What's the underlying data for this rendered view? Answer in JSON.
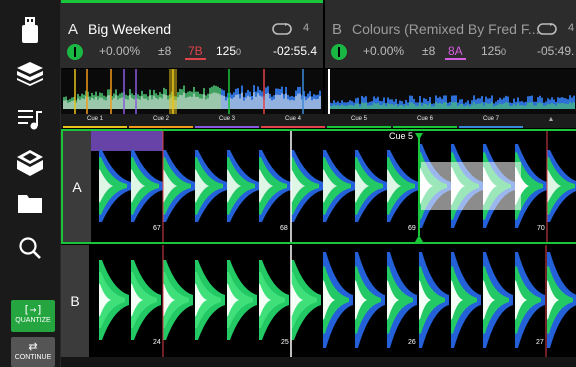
{
  "sidebar": {
    "items": [
      {
        "name": "usb-icon"
      },
      {
        "name": "crates-icon"
      },
      {
        "name": "playlist-icon"
      },
      {
        "name": "library-icon"
      },
      {
        "name": "folder-icon"
      },
      {
        "name": "search-icon"
      }
    ],
    "quantize": {
      "glyph": "[→]",
      "label": "QUANTIZE"
    },
    "continue": {
      "glyph": "⇄",
      "label": "CONTINUE"
    }
  },
  "deckA": {
    "letter": "A",
    "title": "Big Weekend",
    "loop_count": "4",
    "pitch": "+0.00%",
    "range": "±8",
    "key": "7B",
    "bpm": "125",
    "bpm_decimal": "0",
    "time": "-02:55.4",
    "key_color": "#e2424a"
  },
  "deckB": {
    "letter": "B",
    "title": "Colours (Remixed By Fred F...",
    "loop_count": "4",
    "pitch": "+0.00%",
    "range": "±8",
    "key": "8A",
    "bpm": "125",
    "bpm_decimal": "0",
    "time": "-05:49.",
    "key_color": "#d65ee0"
  },
  "cues": [
    {
      "label": "Cue 1",
      "color": "#e8c21b"
    },
    {
      "label": "Cue 2",
      "color": "#f29b1a"
    },
    {
      "label": "Cue 3",
      "color": "#8a5ae0"
    },
    {
      "label": "Cue 4",
      "color": "#e2424a"
    },
    {
      "label": "Cue 5",
      "color": "#19c63a"
    },
    {
      "label": "Cue 6",
      "color": "#19c63a"
    },
    {
      "label": "Cue 7",
      "color": "#3a8ad8"
    }
  ],
  "cue_up_arrow": "▲",
  "laneA": {
    "letter": "A",
    "active_cue": "Cue 5",
    "beats": [
      "67",
      "68",
      "69",
      "70"
    ]
  },
  "laneB": {
    "letter": "B",
    "beats": [
      "24",
      "25",
      "26",
      "27"
    ]
  },
  "colors": {
    "accent": "#19c63a",
    "blue": "#2461d8",
    "white": "#ffffff"
  }
}
